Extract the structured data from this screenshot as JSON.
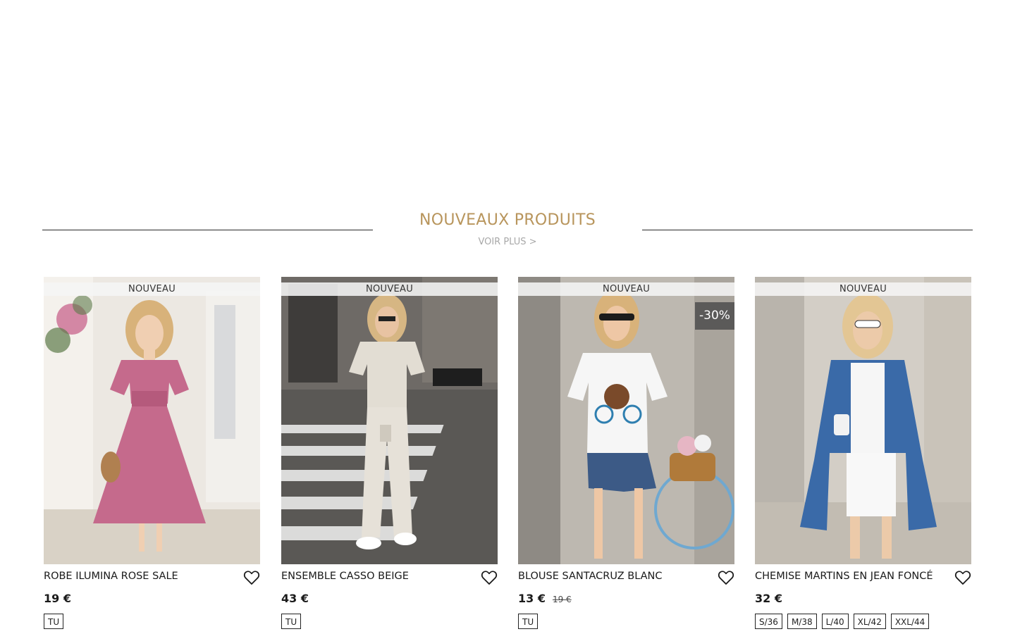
{
  "section": {
    "title": "NOUVEAUX PRODUITS",
    "see_more": "VOIR PLUS >"
  },
  "products": [
    {
      "badge": "NOUVEAU",
      "name": "ROBE ILUMINA ROSE SALE",
      "price": "19 €",
      "old_price": "",
      "discount": "",
      "sizes": [
        "TU"
      ],
      "image_colors": {
        "bg": "#e9e4dc",
        "garment": "#c56a8c",
        "hair": "#d8b27a"
      }
    },
    {
      "badge": "NOUVEAU",
      "name": "ENSEMBLE CASSO BEIGE",
      "price": "43 €",
      "old_price": "",
      "discount": "",
      "sizes": [
        "TU"
      ],
      "image_colors": {
        "bg": "#6d6a66",
        "garment": "#e2ddd3",
        "hair": "#d6b683"
      }
    },
    {
      "badge": "NOUVEAU",
      "name": "BLOUSE SANTACRUZ BLANC",
      "price": "13 €",
      "old_price": "19 €",
      "discount": "-30%",
      "sizes": [
        "TU"
      ],
      "image_colors": {
        "bg": "#bdb8b0",
        "garment": "#f4f4f4",
        "hair": "#d8b27a"
      }
    },
    {
      "badge": "NOUVEAU",
      "name": "CHEMISE MARTINS EN JEAN FONCÉ",
      "price": "32 €",
      "old_price": "",
      "discount": "",
      "sizes": [
        "S/36",
        "M/38",
        "L/40",
        "XL/42",
        "XXL/44"
      ],
      "image_colors": {
        "bg": "#d3cec6",
        "garment": "#3a6aa8",
        "hair": "#e3c694"
      }
    }
  ],
  "icons": {
    "wishlist": "heart-outline-icon"
  },
  "colors": {
    "accent": "#b8955c",
    "muted": "#a8a8a8",
    "text": "#1a1a1a"
  }
}
